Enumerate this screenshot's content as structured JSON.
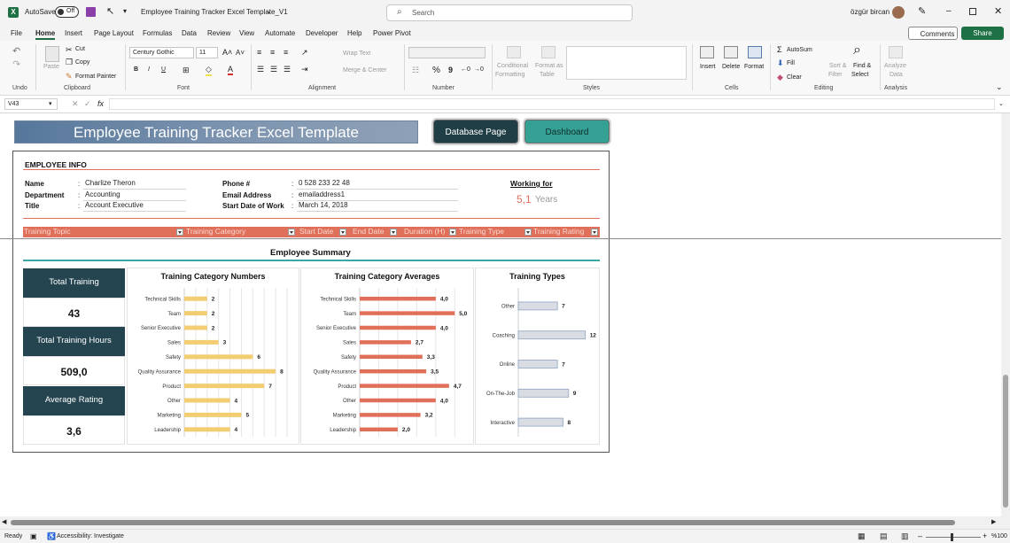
{
  "titlebar": {
    "autosave_label": "AutoSave",
    "autosave_state": "Off",
    "doc_title": "Employee Training Tracker Excel Template_V1",
    "search_placeholder": "Search",
    "user_name": "özgür bircan"
  },
  "menu": {
    "items": [
      "File",
      "Home",
      "Insert",
      "Page Layout",
      "Formulas",
      "Data",
      "Review",
      "View",
      "Automate",
      "Developer",
      "Help",
      "Power Pivot"
    ],
    "active": "Home",
    "comments_label": "Comments",
    "share_label": "Share"
  },
  "ribbon": {
    "undo_group": "Undo",
    "clipboard": {
      "group": "Clipboard",
      "paste": "Paste",
      "cut": "Cut",
      "copy": "Copy",
      "format_painter": "Format Painter"
    },
    "font": {
      "group": "Font",
      "family": "Century Gothic",
      "size": "11",
      "bold": "B",
      "italic": "I",
      "underline": "U"
    },
    "alignment": {
      "group": "Alignment",
      "wrap_text": "Wrap Text",
      "merge_center": "Merge & Center"
    },
    "number": {
      "group": "Number",
      "percent": "%",
      "comma": "9"
    },
    "styles": {
      "group": "Styles",
      "conditional_1": "Conditional",
      "conditional_2": "Formatting",
      "format_table_1": "Format as",
      "format_table_2": "Table"
    },
    "cells": {
      "group": "Cells",
      "insert": "Insert",
      "delete": "Delete",
      "format": "Format"
    },
    "editing": {
      "group": "Editing",
      "autosum": "AutoSum",
      "fill": "Fill",
      "clear": "Clear",
      "sort_filter_1": "Sort &",
      "sort_filter_2": "Filter",
      "find_select_1": "Find &",
      "find_select_2": "Select"
    },
    "analysis": {
      "group": "Analysis",
      "analyze_1": "Analyze",
      "analyze_2": "Data"
    }
  },
  "formula_bar": {
    "name_box": "V43",
    "fx": "fx",
    "formula": ""
  },
  "sheet": {
    "banner_title": "Employee Training Tracker Excel Template",
    "database_button": "Database Page",
    "dashboard_button": "Dashboard",
    "colors": {
      "banner": "#5e7ea0",
      "db_button": "#1f3e45",
      "dash_button": "#35a094",
      "header_orange": "#e1705a",
      "bar_yellow": "#f2cd72",
      "bar_orange": "#e1705a",
      "bar_gray": "#d9dde3",
      "stat_dark": "#24444f",
      "teal_line": "#3aa6a6"
    },
    "employee_info": {
      "heading": "EMPLOYEE INFO",
      "name_label": "Name",
      "name": "Charlize Theron",
      "department_label": "Department",
      "department": "Accounting",
      "title_label": "Title",
      "title": "Account Executive",
      "phone_label": "Phone #",
      "phone": "0 528 233 22 48",
      "email_label": "Email Address",
      "email": "emailaddress1",
      "start_label": "Start Date of Work",
      "start_date": "March 14, 2018",
      "working_for_label": "Working for",
      "working_years": "5,1",
      "years_label": "Years"
    },
    "table_headers": [
      "Training Topic",
      "Training Category",
      "Start Date",
      "End Date",
      "Duration (H)",
      "Training Type",
      "Training Rating"
    ],
    "summary_title": "Employee Summary",
    "stats": [
      {
        "label": "Total Training",
        "value": "43"
      },
      {
        "label": "Total Training Hours",
        "value": "509,0"
      },
      {
        "label": "Average Rating",
        "value": "3,6"
      }
    ]
  },
  "chart_data": [
    {
      "type": "bar",
      "title": "Training Category Numbers",
      "orientation": "horizontal",
      "categories": [
        "Technical Skills",
        "Team",
        "Senior Executive",
        "Sales",
        "Safety",
        "Quality Assurance",
        "Product",
        "Other",
        "Marketing",
        "Leadership"
      ],
      "values": [
        2,
        2,
        2,
        3,
        6,
        8,
        7,
        4,
        5,
        4
      ],
      "data_labels": [
        "2",
        "2",
        "2",
        "3",
        "6",
        "8",
        "7",
        "4",
        "5",
        "4"
      ],
      "xlim": [
        0,
        9
      ],
      "grid": true
    },
    {
      "type": "bar",
      "title": "Training Category Averages",
      "orientation": "horizontal",
      "categories": [
        "Technical Skills",
        "Team",
        "Senior Executive",
        "Sales",
        "Safety",
        "Quality Assurance",
        "Product",
        "Other",
        "Marketing",
        "Leadership"
      ],
      "values": [
        4.0,
        5.0,
        4.0,
        2.7,
        3.3,
        3.5,
        4.7,
        4.0,
        3.2,
        2.0
      ],
      "data_labels": [
        "4,0",
        "5,0",
        "4,0",
        "2,7",
        "3,3",
        "3,5",
        "4,7",
        "4,0",
        "3,2",
        "2,0"
      ],
      "xlim": [
        0,
        5.5
      ],
      "grid": true
    },
    {
      "type": "bar",
      "title": "Training Types",
      "orientation": "horizontal",
      "categories": [
        "Other",
        "Coaching",
        "Online",
        "On-The-Job",
        "Interactive"
      ],
      "values": [
        7,
        12,
        7,
        9,
        8
      ],
      "data_labels": [
        "7",
        "12",
        "7",
        "9",
        "8"
      ],
      "xlim": [
        0,
        13
      ],
      "grid": false
    }
  ],
  "status": {
    "ready": "Ready",
    "accessibility": "Accessibility: Investigate",
    "zoom": "%100"
  }
}
